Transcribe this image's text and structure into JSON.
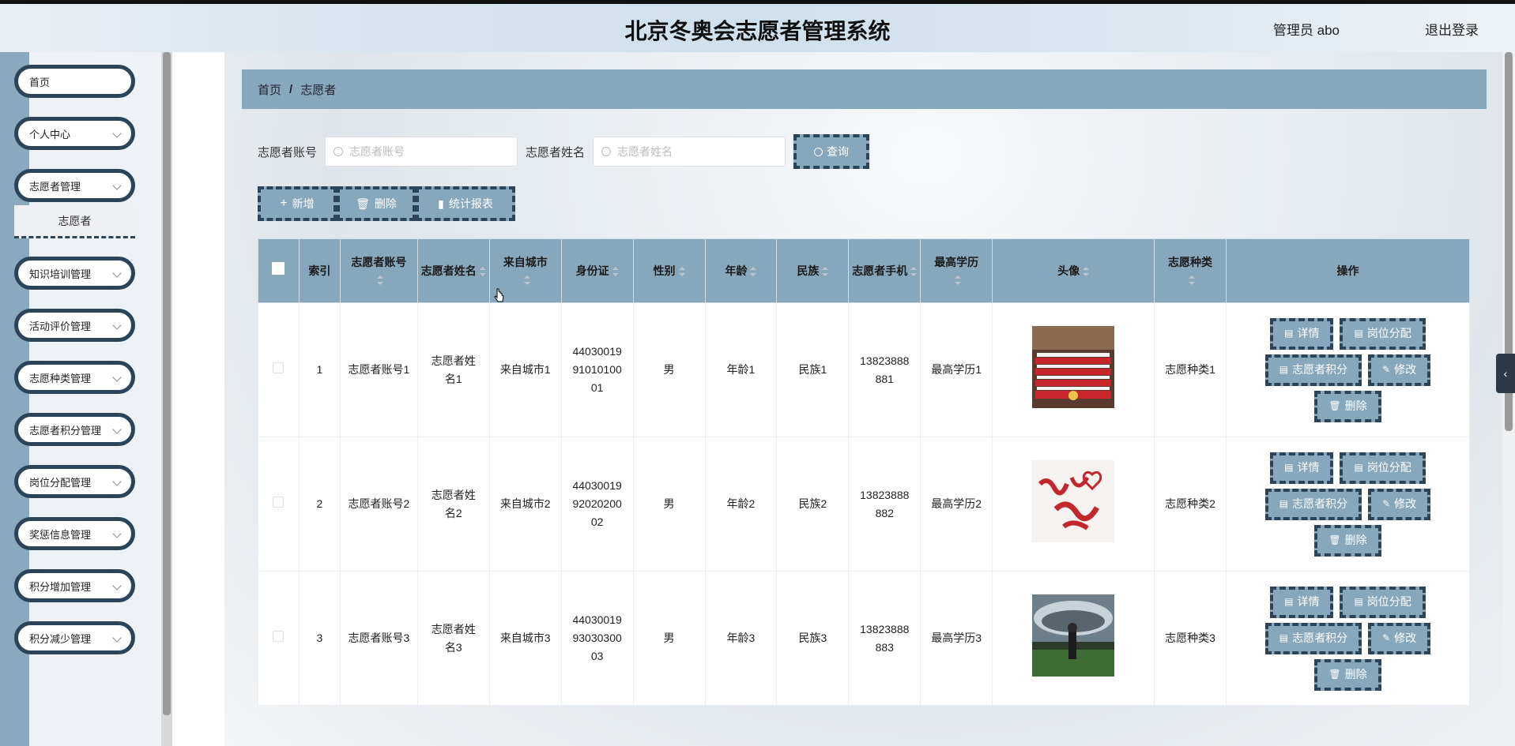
{
  "header": {
    "title": "北京冬奥会志愿者管理系统",
    "user": "管理员 abo",
    "logout": "退出登录"
  },
  "sidebar": {
    "items": [
      {
        "label": "首页",
        "has_arrow": false
      },
      {
        "label": "个人中心",
        "has_arrow": true
      },
      {
        "label": "志愿者管理",
        "has_arrow": true
      },
      {
        "label": "知识培训管理",
        "has_arrow": true
      },
      {
        "label": "活动评价管理",
        "has_arrow": true
      },
      {
        "label": "志愿种类管理",
        "has_arrow": true
      },
      {
        "label": "志愿者积分管理",
        "has_arrow": true
      },
      {
        "label": "岗位分配管理",
        "has_arrow": true
      },
      {
        "label": "奖惩信息管理",
        "has_arrow": true
      },
      {
        "label": "积分增加管理",
        "has_arrow": true
      },
      {
        "label": "积分减少管理",
        "has_arrow": true
      }
    ],
    "submenu_active": "志愿者"
  },
  "breadcrumb": {
    "home": "首页",
    "sep": "/",
    "current": "志愿者"
  },
  "search": {
    "account_label": "志愿者账号",
    "account_placeholder": "志愿者账号",
    "name_label": "志愿者姓名",
    "name_placeholder": "志愿者姓名",
    "query_button": "查询"
  },
  "actions": {
    "add": "新增",
    "delete": "删除",
    "report": "统计报表"
  },
  "table": {
    "columns": [
      "索引",
      "志愿者账号",
      "志愿者姓名",
      "来自城市",
      "身份证",
      "性别",
      "年龄",
      "民族",
      "志愿者手机",
      "最高学历",
      "头像",
      "志愿种类",
      "操作"
    ],
    "rows": [
      {
        "index": "1",
        "account": "志愿者账号1",
        "name": "志愿者姓名1",
        "city": "来自城市1",
        "id_card": "440300199101010001",
        "gender": "男",
        "age": "年龄1",
        "ethnicity": "民族1",
        "phone": "13823888881",
        "education": "最高学历1",
        "type": "志愿种类1",
        "avatar_icon": "volunteers-group-photo"
      },
      {
        "index": "2",
        "account": "志愿者账号2",
        "name": "志愿者姓名2",
        "city": "来自城市2",
        "id_card": "440300199202020002",
        "gender": "男",
        "age": "年龄2",
        "ethnicity": "民族2",
        "phone": "13823888882",
        "education": "最高学历2",
        "type": "志愿种类2",
        "avatar_icon": "calligraphy-volunteer-photo"
      },
      {
        "index": "3",
        "account": "志愿者账号3",
        "name": "志愿者姓名3",
        "city": "来自城市3",
        "id_card": "440300199303030003",
        "gender": "男",
        "age": "年龄3",
        "ethnicity": "民族3",
        "phone": "13823888883",
        "education": "最高学历3",
        "type": "志愿种类3",
        "avatar_icon": "stadium-photo"
      }
    ],
    "ops": {
      "detail": "详情",
      "post": "岗位分配",
      "points": "志愿者积分",
      "edit": "修改",
      "delete": "删除"
    }
  },
  "colors": {
    "accent": "#87a8bc",
    "border_dark": "#2b4459"
  }
}
